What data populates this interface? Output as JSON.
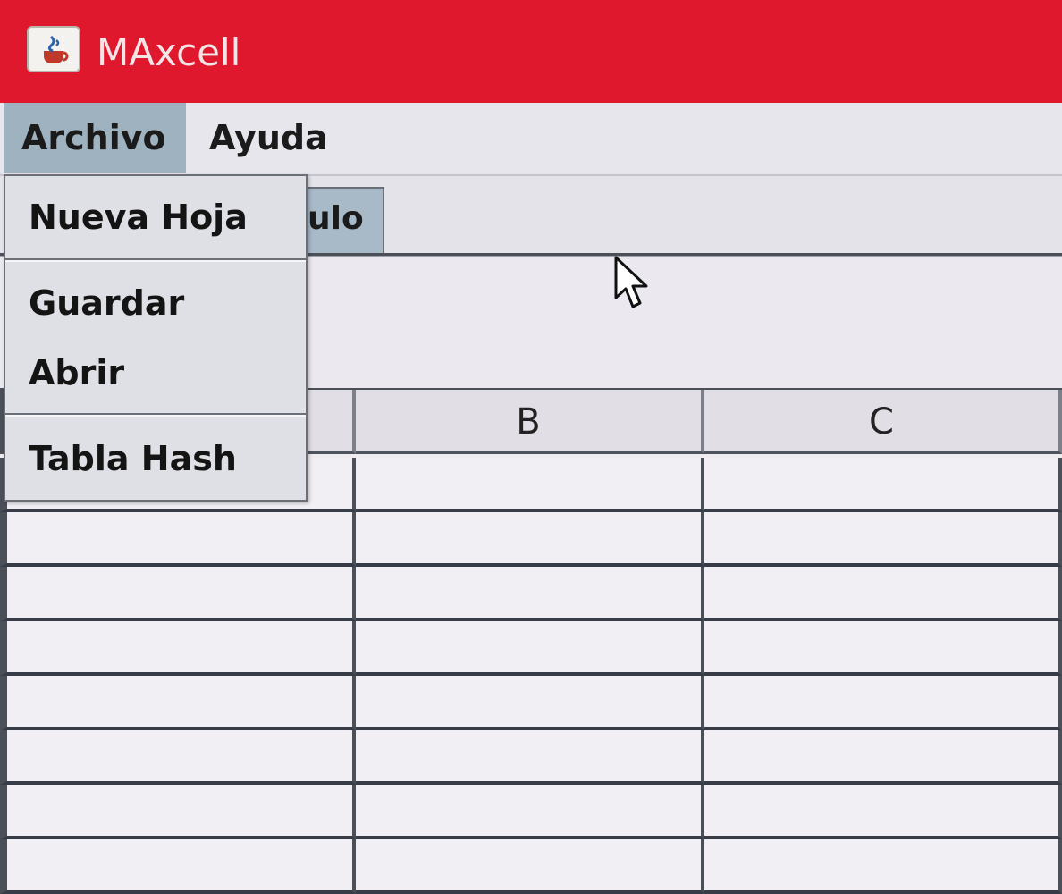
{
  "window": {
    "title": "MAxcell",
    "icon": "java-coffee-cup-icon"
  },
  "menubar": {
    "items": [
      "Archivo",
      "Ayuda"
    ],
    "active": "Archivo"
  },
  "tabs": [
    {
      "label": "ulo",
      "selected": true
    }
  ],
  "archivo_menu": {
    "items": [
      "Nueva Hoja",
      "Guardar",
      "Abrir",
      "Tabla Hash"
    ]
  },
  "table": {
    "columns": [
      "",
      "B",
      "C"
    ],
    "rows": [
      [
        "",
        "",
        ""
      ],
      [
        "",
        "",
        ""
      ],
      [
        "",
        "",
        ""
      ],
      [
        "",
        "",
        ""
      ],
      [
        "",
        "",
        ""
      ],
      [
        "",
        "",
        ""
      ],
      [
        "",
        "",
        ""
      ],
      [
        "",
        "",
        ""
      ]
    ]
  },
  "colors": {
    "titlebar": "#e0182e",
    "active_menu": "#9fb2bf",
    "selected_tab": "#a8bac8"
  }
}
